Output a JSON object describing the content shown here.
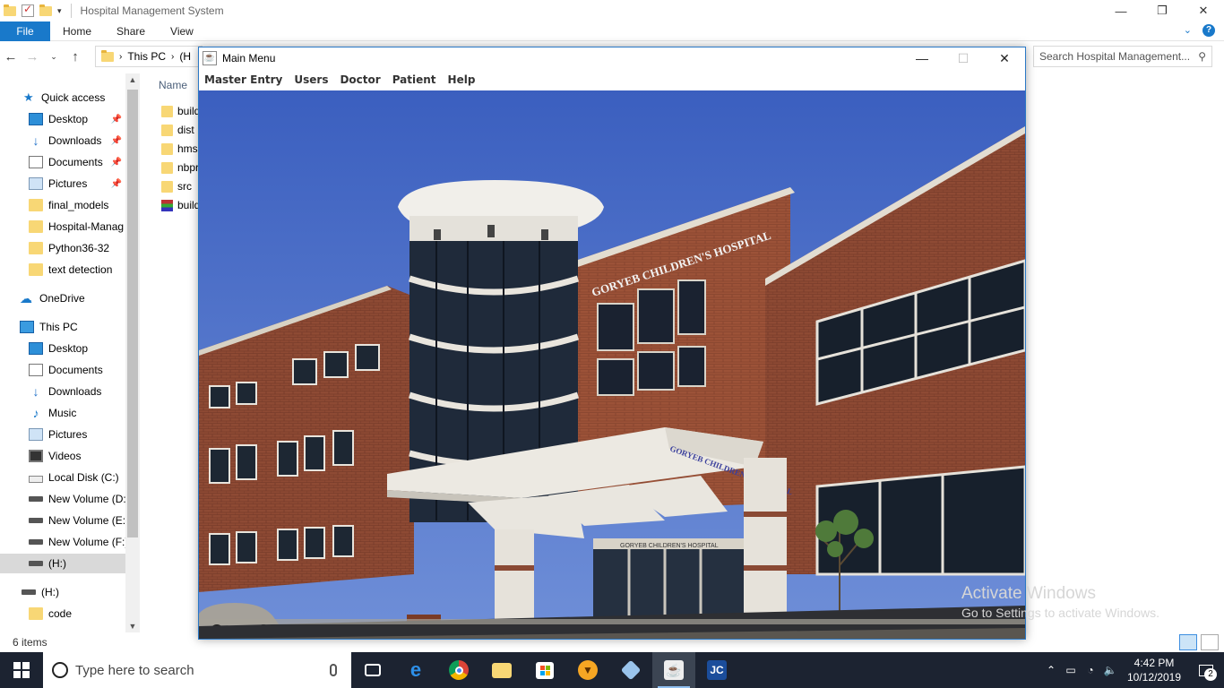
{
  "explorer": {
    "title": "Hospital Management System",
    "ribbon_tabs": [
      "File",
      "Home",
      "Share",
      "View"
    ],
    "address": {
      "crumb1": "This PC",
      "crumb2": "(H"
    },
    "search_placeholder": "Search Hospital Management...",
    "nav_items": [
      {
        "label": "Quick access",
        "icon": "star-icon"
      },
      {
        "label": "Desktop",
        "icon": "desktop-icon",
        "pinned": true
      },
      {
        "label": "Downloads",
        "icon": "downloads-icon",
        "pinned": true
      },
      {
        "label": "Documents",
        "icon": "documents-icon",
        "pinned": true
      },
      {
        "label": "Pictures",
        "icon": "pictures-icon",
        "pinned": true
      },
      {
        "label": "final_models",
        "icon": "folder-icon"
      },
      {
        "label": "Hospital-Manag",
        "icon": "folder-icon"
      },
      {
        "label": "Python36-32",
        "icon": "folder-icon"
      },
      {
        "label": "text detection",
        "icon": "folder-icon"
      },
      {
        "label": "OneDrive",
        "icon": "cloud-icon"
      },
      {
        "label": "This PC",
        "icon": "computer-icon"
      },
      {
        "label": "Desktop",
        "icon": "desktop-icon"
      },
      {
        "label": "Documents",
        "icon": "documents-icon"
      },
      {
        "label": "Downloads",
        "icon": "downloads-icon"
      },
      {
        "label": "Music",
        "icon": "music-icon"
      },
      {
        "label": "Pictures",
        "icon": "pictures-icon"
      },
      {
        "label": "Videos",
        "icon": "videos-icon"
      },
      {
        "label": "Local Disk (C:)",
        "icon": "disk-icon"
      },
      {
        "label": "New Volume (D:",
        "icon": "drive-icon"
      },
      {
        "label": "New Volume (E:)",
        "icon": "drive-icon"
      },
      {
        "label": "New Volume (F:)",
        "icon": "drive-icon"
      },
      {
        "label": " (H:)",
        "icon": "drive-icon",
        "selected": true
      },
      {
        "label": " (H:)",
        "icon": "drive-icon"
      },
      {
        "label": "code",
        "icon": "folder-icon"
      }
    ],
    "column_name": "Name",
    "files": [
      {
        "name": "build",
        "icon": "folder-icon"
      },
      {
        "name": "dist",
        "icon": "folder-icon"
      },
      {
        "name": "hms",
        "icon": "folder-icon"
      },
      {
        "name": "nbproject",
        "icon": "folder-icon"
      },
      {
        "name": "src",
        "icon": "folder-icon"
      },
      {
        "name": "build",
        "icon": "archive-icon"
      }
    ],
    "status": "6 items"
  },
  "main_window": {
    "title": "Main Menu",
    "menu": [
      "Master Entry",
      "Users",
      "Doctor",
      "Patient",
      "Help"
    ],
    "image": {
      "sign_building": "GORYEB CHILDREN'S HOSPITAL",
      "sign_canopy": "GORYEB CHILDREN'S HOSPITAL",
      "sign_entrance": "GORYEB CHILDREN'S HOSPITAL"
    }
  },
  "watermark": {
    "line1": "Activate Windows",
    "line2": "Go to Settings to activate Windows."
  },
  "taskbar": {
    "search_placeholder": "Type here to search",
    "apps": [
      "task-view-icon",
      "edge-icon",
      "chrome-icon",
      "file-explorer-icon",
      "store-icon",
      "brave-icon",
      "box-icon",
      "java-icon",
      "netbeans-icon"
    ],
    "time": "4:42 PM",
    "date": "10/12/2019",
    "notification_count": "2"
  }
}
